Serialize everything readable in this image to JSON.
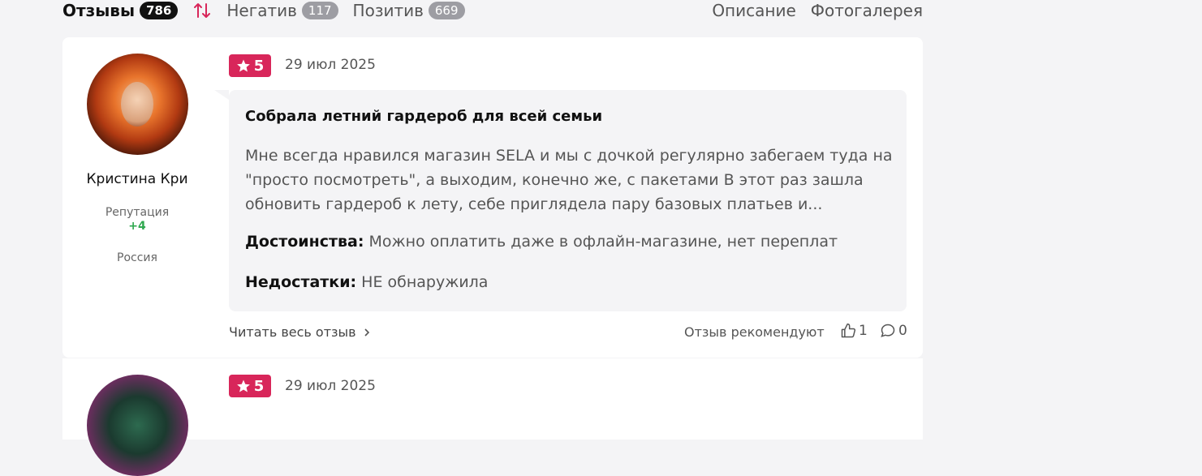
{
  "tabs": {
    "reviews": {
      "label": "Отзывы",
      "count": "786"
    },
    "negative": {
      "label": "Негатив",
      "count": "117"
    },
    "positive": {
      "label": "Позитив",
      "count": "669"
    }
  },
  "links": {
    "description": "Описание",
    "gallery": "Фотогалерея"
  },
  "review1": {
    "author": "Кристина Кри",
    "reputation_label": "Репутация",
    "reputation_value": "+4",
    "country": "Россия",
    "rating": "5",
    "date": "29 июл 2025",
    "title": "Собрала летний гардероб для всей семьи",
    "text": "Мне всегда нравился магазин SELA и мы с дочкой регулярно забегаем туда на \"просто посмотреть\", а выходим, конечно же, с пакетами В этот раз зашла обновить гардероб к лету, себе приглядела пару базовых платьев и...",
    "pros_label": "Достоинства:",
    "pros": "Можно оплатить даже в офлайн-магазине, нет переплат",
    "cons_label": "Недостатки:",
    "cons": "НЕ обнаружила",
    "read_more": "Читать весь отзыв",
    "recommend": "Отзыв рекомендуют",
    "likes": "1",
    "comments": "0"
  },
  "review2": {
    "rating": "5",
    "date": "29 июл 2025"
  },
  "colors": {
    "accent": "#d8265a",
    "reputation": "#2fa84f"
  },
  "icons": [
    "sort-icon",
    "star-icon",
    "chevron-right-icon",
    "thumbs-up-icon",
    "comment-icon"
  ]
}
